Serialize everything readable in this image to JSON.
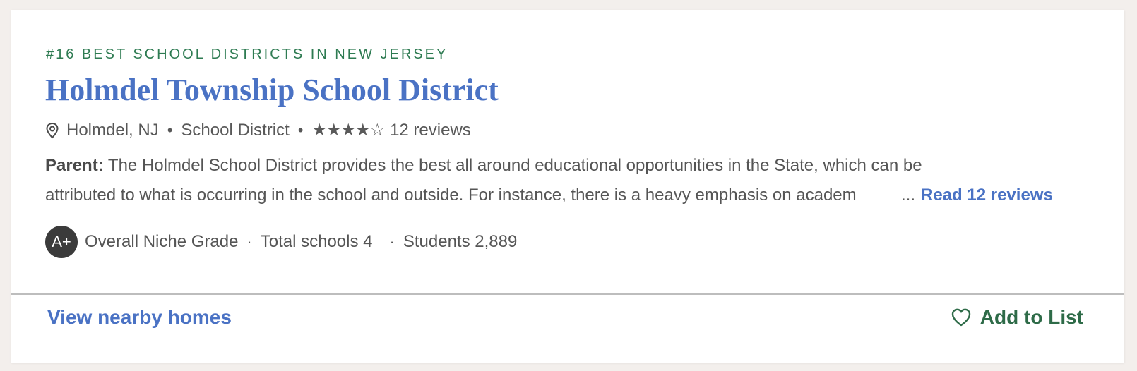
{
  "card": {
    "rank_label": "#16 BEST SCHOOL DISTRICTS IN NEW JERSEY",
    "title": "Holmdel Township School District",
    "location": "Holmdel, NJ",
    "type": "School District",
    "rating": {
      "stars_filled": 4,
      "stars_total": 5,
      "reviews_text": "12 reviews"
    },
    "review": {
      "author_label": "Parent:",
      "line1": "The Holmdel School District provides the best all around educational opportunities in the State, which can be",
      "line2": "attributed to what is occurring in the school and outside. For instance, there is a heavy emphasis on academ",
      "ellipsis": "...",
      "read_more": "Read 12 reviews"
    },
    "grade": {
      "badge": "A+",
      "label": "Overall Niche Grade",
      "total_schools": "Total schools 4",
      "students": "Students 2,889"
    },
    "footer": {
      "nearby_homes": "View nearby homes",
      "add_to_list": "Add to List"
    }
  },
  "icons": {
    "location": "map-pin-icon",
    "star_filled": "star-filled-icon",
    "star_empty": "star-outline-icon",
    "heart": "heart-outline-icon"
  },
  "colors": {
    "rank_green": "#2e7b52",
    "title_blue": "#4a72c4",
    "link_blue": "#4a72c4",
    "footer_green": "#2e6b48",
    "badge_dark": "#3b3b3b",
    "page_background": "#f3efec"
  }
}
